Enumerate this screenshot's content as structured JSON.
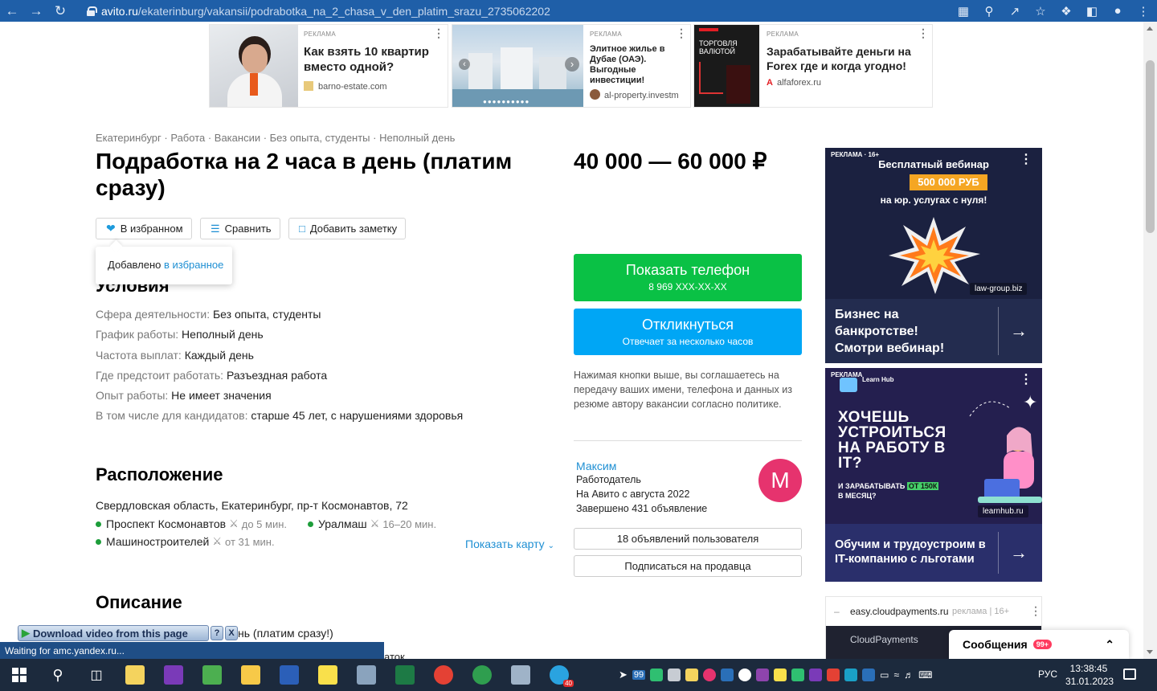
{
  "browser": {
    "url_host": "avito.ru",
    "url_path": "/ekaterinburg/vakansii/podrabotka_na_2_chasa_v_den_platim_srazu_2735062202",
    "status_text": "Waiting for amc.yandex.ru..."
  },
  "top_ads": [
    {
      "label": "РЕКЛАМА",
      "title": "Как взять 10 квартир вместо одной?",
      "source": "barno-estate.com"
    },
    {
      "label": "РЕКЛАМА",
      "title": "Элитное жилье в Дубае (ОАЭ). Выгодные инвестиции!",
      "source": "al-property.investm"
    },
    {
      "label": "РЕКЛАМА",
      "image_text": "ТОРГОВЛЯ ВАЛЮТОЙ",
      "title": "Зарабатывайте деньги на Forex где и когда угодно!",
      "source": "alfaforex.ru"
    }
  ],
  "breadcrumbs": "Екатеринбург · Работа · Вакансии · Без опыта, студенты · Неполный день",
  "listing": {
    "title": "Подработка на 2 часа в день (платим сразу)",
    "price": "40 000 — 60 000 ₽"
  },
  "actions": {
    "favorite": "В избранном",
    "compare": "Сравнить",
    "note": "Добавить заметку"
  },
  "tooltip": {
    "text": "Добавлено ",
    "link": "в избранное"
  },
  "conditions": {
    "heading": "Условия",
    "rows": [
      {
        "key": "Сфера деятельности:",
        "value": "Без опыта, студенты"
      },
      {
        "key": "График работы:",
        "value": "Неполный день"
      },
      {
        "key": "Частота выплат:",
        "value": "Каждый день"
      },
      {
        "key": "Где предстоит работать:",
        "value": "Разъездная работа"
      },
      {
        "key": "Опыт работы:",
        "value": "Не имеет значения"
      },
      {
        "key": "В том числе для кандидатов:",
        "value": "старше 45 лет, с нарушениями здоровья"
      }
    ]
  },
  "location": {
    "heading": "Расположение",
    "address": "Свердловская область, Екатеринбург, пр-т Космонавтов, 72",
    "metro": [
      {
        "name": "Проспект Космонавтов",
        "time": "до 5 мин."
      },
      {
        "name": "Уралмаш",
        "time": "16–20 мин."
      },
      {
        "name": "Машиностроителей",
        "time": "от 31 мин."
      }
    ],
    "show_map": "Показать карту"
  },
  "description": {
    "heading": "Описание",
    "partial": "нь (платим сразу!)",
    "partial2": "аток"
  },
  "contact": {
    "phone_label": "Показать телефон",
    "phone": "8 969 XXX-XX-XX",
    "respond_label": "Откликнуться",
    "respond_sub": "Отвечает за несколько часов",
    "consent": "Нажимая кнопки выше, вы соглашаетесь на передачу ваших имени, телефона и данных из резюме автору вакансии согласно политике."
  },
  "seller": {
    "name": "Максим",
    "role": "Работодатель",
    "since": "На Авито с августа 2022",
    "completed": "Завершено 431 объявление",
    "initial": "М",
    "listings_btn": "18 объявлений пользователя",
    "subscribe_btn": "Подписаться на продавца"
  },
  "side_ads": {
    "ad1": {
      "label": "РЕКЛАМА · 16+",
      "title": "Бесплатный вебинар",
      "badge": "500 000 РУБ",
      "subtitle": "на юр. услугах с нуля!",
      "source": "law-group.biz",
      "bottom": "Бизнес на банкротстве! Смотри вебинар!"
    },
    "ad2": {
      "label": "РЕКЛАМА",
      "brand": "Learn Hub",
      "headline": "ХОЧЕШЬ УСТРОИТЬСЯ НА РАБОТУ В IT?",
      "sub_pre": "И ЗАРАБАТЫВАТЬ",
      "sub_badge": "ОТ 150К",
      "sub_post": "В МЕСЯЦ?",
      "source": "learnhub.ru",
      "bottom": "Обучим и трудоустроим в IT-компанию с льготами"
    },
    "ad3": {
      "source": "easy.cloudpayments.ru",
      "meta": "реклама | 16+",
      "brand": "CloudPayments"
    }
  },
  "messages": {
    "label": "Сообщения",
    "badge": "99+"
  },
  "download_bar": {
    "label": "Download video from this page",
    "help": "?",
    "close": "X"
  },
  "taskbar": {
    "lang": "РУС",
    "time": "13:38:45",
    "date": "31.01.2023",
    "badge_99": "99",
    "badge_40": "40"
  },
  "colors": {
    "green": "#0AC145",
    "blue": "#00A6F5",
    "link": "#1E8FD3",
    "avatar": "#E6336E"
  }
}
